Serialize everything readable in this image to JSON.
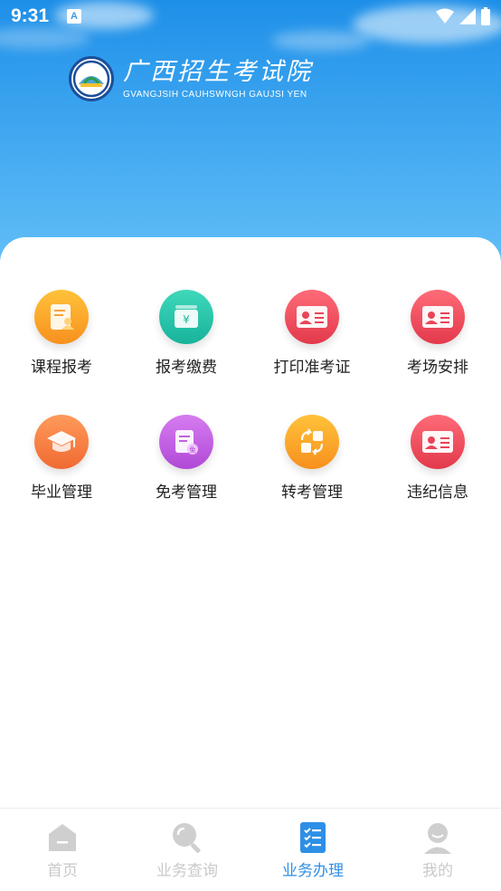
{
  "status_bar": {
    "time": "9:31",
    "notification": "A"
  },
  "header": {
    "title_cn": "广西招生考试院",
    "title_en": "GVANGJSIH CAUHSWNGH GAUJSI YEN"
  },
  "services": [
    {
      "label": "课程报考",
      "icon": "document-person-icon",
      "color": "#f9a316"
    },
    {
      "label": "报考缴费",
      "icon": "yen-payment-icon",
      "color": "#22c2a6"
    },
    {
      "label": "打印准考证",
      "icon": "id-card-icon",
      "color": "#ec4a5b"
    },
    {
      "label": "考场安排",
      "icon": "id-card-icon",
      "color": "#ec4a5b"
    },
    {
      "label": "毕业管理",
      "icon": "graduation-cap-icon",
      "color": "#f57c43"
    },
    {
      "label": "免考管理",
      "icon": "exempt-document-icon",
      "color": "#c05be0"
    },
    {
      "label": "转考管理",
      "icon": "transfer-icon",
      "color": "#f9a316"
    },
    {
      "label": "违纪信息",
      "icon": "id-card-icon",
      "color": "#ec4a5b"
    }
  ],
  "tabbar": {
    "items": [
      {
        "label": "首页",
        "icon": "home-icon",
        "active": false
      },
      {
        "label": "业务查询",
        "icon": "search-icon",
        "active": false
      },
      {
        "label": "业务办理",
        "icon": "checklist-icon",
        "active": true
      },
      {
        "label": "我的",
        "icon": "user-icon",
        "active": false
      }
    ],
    "active_color": "#2d8fe6",
    "inactive_color": "#c9c9c9"
  }
}
